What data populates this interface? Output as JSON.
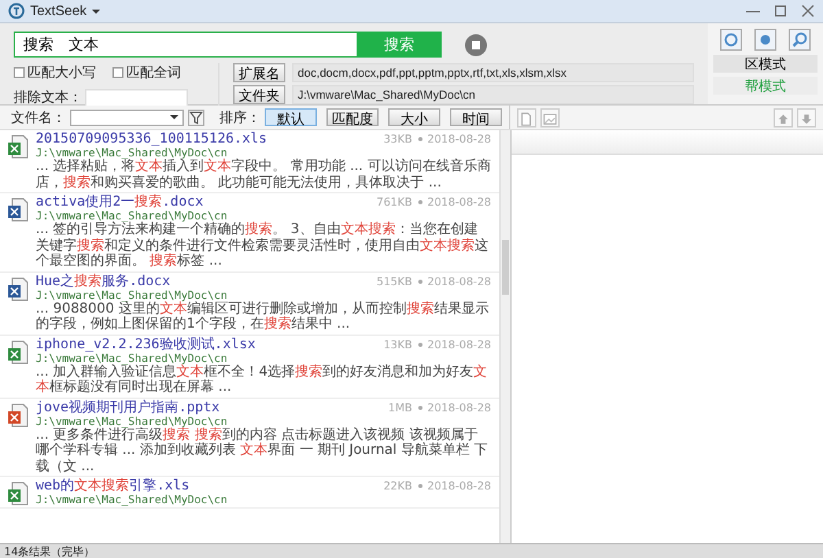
{
  "window": {
    "title": "TextSeek"
  },
  "search": {
    "value": "搜索　文本",
    "button": "搜索"
  },
  "options": [
    {
      "label": "匹配大小写",
      "checked": false
    },
    {
      "label": "匹配全词",
      "checked": false
    }
  ],
  "exclude": {
    "label": "排除文本："
  },
  "filters": [
    {
      "button": "扩展名",
      "value": "doc,docm,docx,pdf,ppt,pptm,pptx,rtf,txt,xls,xlsm,xlsx"
    },
    {
      "button": "文件夹",
      "value": "J:\\vmware\\Mac_Shared\\MyDoc\\cn"
    }
  ],
  "modes": [
    {
      "label": "区模式",
      "selected": false
    },
    {
      "label": "帮模式",
      "selected": true
    }
  ],
  "toolbar": {
    "filename_label": "文件名：",
    "sort_label": "排序：",
    "sort": [
      {
        "label": "默认",
        "selected": true
      },
      {
        "label": "匹配度",
        "selected": false
      },
      {
        "label": "大小",
        "selected": false
      },
      {
        "label": "时间",
        "selected": false
      }
    ]
  },
  "results": [
    {
      "kind": "xls",
      "name": [
        {
          "text": "20150709095336_100115126.xls",
          "highlight": false
        }
      ],
      "path": "J:\\vmware\\Mac_Shared\\MyDoc\\cn",
      "size": "33KB",
      "date": "2018-08-28",
      "snippet": [
        {
          "text": "... 选择粘贴，将",
          "highlight": false
        },
        {
          "text": "文本",
          "highlight": true
        },
        {
          "text": "插入到",
          "highlight": false
        },
        {
          "text": "文本",
          "highlight": true
        },
        {
          "text": "字段中。 常用功能 ... 可以访问在线音乐商店，",
          "highlight": false
        },
        {
          "text": "搜索",
          "highlight": true
        },
        {
          "text": "和购买喜爱的歌曲。 此功能可能无法使用，具体取决于 ...",
          "highlight": false
        }
      ]
    },
    {
      "kind": "doc",
      "name": [
        {
          "text": "activa使用2一",
          "highlight": false
        },
        {
          "text": "搜索",
          "highlight": true
        },
        {
          "text": ".docx",
          "highlight": false
        }
      ],
      "path": "J:\\vmware\\Mac_Shared\\MyDoc\\cn",
      "size": "761KB",
      "date": "2018-08-28",
      "snippet": [
        {
          "text": "... 签的引导方法来构建一个精确的",
          "highlight": false
        },
        {
          "text": "搜索",
          "highlight": true
        },
        {
          "text": "。 3、自由",
          "highlight": false
        },
        {
          "text": "文本搜索",
          "highlight": true
        },
        {
          "text": "：当您在创建关键字",
          "highlight": false
        },
        {
          "text": "搜索",
          "highlight": true
        },
        {
          "text": "和定义的条件进行文件检索需要灵活性时，使用自由",
          "highlight": false
        },
        {
          "text": "文本搜索",
          "highlight": true
        },
        {
          "text": "这个最空图的界面。 ",
          "highlight": false
        },
        {
          "text": "搜索",
          "highlight": true
        },
        {
          "text": "标签 ...",
          "highlight": false
        }
      ]
    },
    {
      "kind": "doc",
      "name": [
        {
          "text": "Hue之",
          "highlight": false
        },
        {
          "text": "搜索",
          "highlight": true
        },
        {
          "text": "服务.docx",
          "highlight": false
        }
      ],
      "path": "J:\\vmware\\Mac_Shared\\MyDoc\\cn",
      "size": "515KB",
      "date": "2018-08-28",
      "snippet": [
        {
          "text": "... 9088000 这里的",
          "highlight": false
        },
        {
          "text": "文本",
          "highlight": true
        },
        {
          "text": "编辑区可进行删除或增加，从而控制",
          "highlight": false
        },
        {
          "text": "搜索",
          "highlight": true
        },
        {
          "text": "结果显示的字段，例如上图保留的1个字段，在",
          "highlight": false
        },
        {
          "text": "搜索",
          "highlight": true
        },
        {
          "text": "结果中 ...",
          "highlight": false
        }
      ]
    },
    {
      "kind": "xls",
      "name": [
        {
          "text": "iphone_v2.2.236验收测试.xlsx",
          "highlight": false
        }
      ],
      "path": "J:\\vmware\\Mac_Shared\\MyDoc\\cn",
      "size": "13KB",
      "date": "2018-08-28",
      "snippet": [
        {
          "text": "... 加入群输入验证信息",
          "highlight": false
        },
        {
          "text": "文本",
          "highlight": true
        },
        {
          "text": "框不全！4选择",
          "highlight": false
        },
        {
          "text": "搜索",
          "highlight": true
        },
        {
          "text": "到的好友消息和加为好友",
          "highlight": false
        },
        {
          "text": "文本",
          "highlight": true
        },
        {
          "text": "框标题没有同时出现在屏幕 ...",
          "highlight": false
        }
      ]
    },
    {
      "kind": "ppt",
      "name": [
        {
          "text": "jove视频期刊用户指南.pptx",
          "highlight": false
        }
      ],
      "path": "J:\\vmware\\Mac_Shared\\MyDoc\\cn",
      "size": "1MB",
      "date": "2018-08-28",
      "snippet": [
        {
          "text": "... 更多条件进行高级",
          "highlight": false
        },
        {
          "text": "搜索",
          "highlight": true
        },
        {
          "text": " 搜索",
          "highlight": true
        },
        {
          "text": "到的内容 点击标题进入该视频 该视频属于哪个学科专辑 ... 添加到收藏列表 ",
          "highlight": false
        },
        {
          "text": "文本",
          "highlight": true
        },
        {
          "text": "界面 一 期刊 Journal 导航菜单栏 下载（文 ...",
          "highlight": false
        }
      ]
    },
    {
      "kind": "xls",
      "name": [
        {
          "text": "web的",
          "highlight": false
        },
        {
          "text": "文本搜索",
          "highlight": true
        },
        {
          "text": "引擎.xls",
          "highlight": false
        }
      ],
      "path": "J:\\vmware\\Mac_Shared\\MyDoc\\cn",
      "size": "22KB",
      "date": "2018-08-28"
    }
  ],
  "status_bar": "14条结果（完毕）"
}
